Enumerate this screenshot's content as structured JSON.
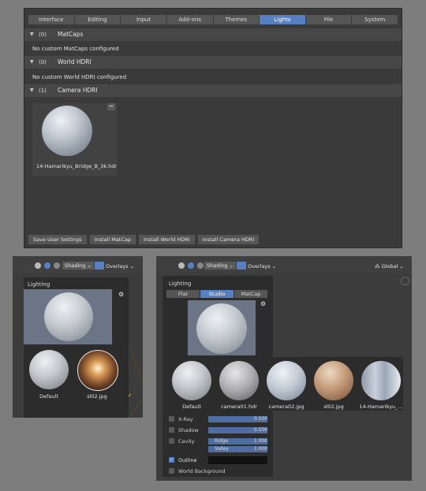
{
  "prefs": {
    "tabs": [
      {
        "label": "Interface"
      },
      {
        "label": "Editing"
      },
      {
        "label": "Input"
      },
      {
        "label": "Add-ons"
      },
      {
        "label": "Themes"
      },
      {
        "label": "Lights",
        "active": true
      },
      {
        "label": "File"
      },
      {
        "label": "System"
      }
    ],
    "matcaps": {
      "count": "(0)",
      "title": "MatCaps",
      "message": "No custom MatCaps configured"
    },
    "world_hdri": {
      "count": "(0)",
      "title": "World HDRI",
      "message": "No custom World HDRI configured"
    },
    "camera_hdri": {
      "count": "(1)",
      "title": "Camera HDRI",
      "item_name": "14-Hamarikyu_Bridge_B_3k.hdr",
      "remove_label": "−"
    },
    "footer": {
      "save": "Save User Settings",
      "install_matcap": "Install MatCap",
      "install_world": "Install World HDRI",
      "install_camera": "Install Camera HDRI"
    }
  },
  "left_panel": {
    "header": {
      "shading": "Shading",
      "overlays": "Overlays"
    },
    "lighting_label": "Lighting",
    "thumbs": [
      {
        "name": "Default"
      },
      {
        "name": "sl02.jpg"
      }
    ]
  },
  "right_panel": {
    "header": {
      "shading": "Shading",
      "overlays": "Overlays",
      "orientation": "Global"
    },
    "lighting_label": "Lighting",
    "segments": [
      {
        "label": "Flat"
      },
      {
        "label": "Studio",
        "active": true
      },
      {
        "label": "MatCap"
      }
    ],
    "thumbs": [
      {
        "name": "Default"
      },
      {
        "name": "camera01.hdr"
      },
      {
        "name": "camera02.jpg"
      },
      {
        "name": "sl02.jpg"
      },
      {
        "name": "14-Hamarikyu_..."
      }
    ],
    "options": {
      "xray": {
        "label": "X-Ray",
        "value": "0.500"
      },
      "shadow": {
        "label": "Shadow",
        "value": "0.500"
      },
      "cavity": {
        "label": "Cavity",
        "ridge_label": "Ridge",
        "ridge": "1.000",
        "valley_label": "Valley",
        "valley": "1.000"
      },
      "outline": {
        "label": "Outline",
        "checked": true
      },
      "world_background": {
        "label": "World Background"
      }
    }
  },
  "colors": {
    "accent": "#5680c2",
    "panel": "#3a3a3a",
    "popup": "#2c2c2c"
  }
}
